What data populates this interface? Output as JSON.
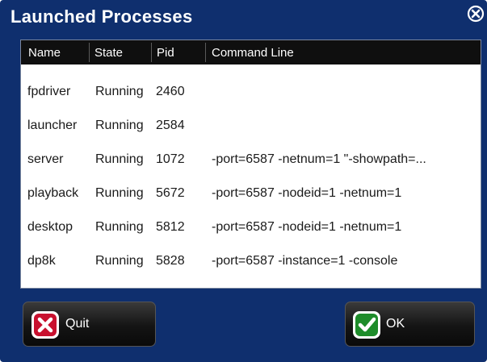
{
  "window": {
    "title": "Launched Processes"
  },
  "table": {
    "columns": [
      "Name",
      "State",
      "Pid",
      "Command Line"
    ],
    "rows": [
      {
        "name": "fpdriver",
        "state": "Running",
        "pid": "2460",
        "cmd": ""
      },
      {
        "name": "launcher",
        "state": "Running",
        "pid": "2584",
        "cmd": ""
      },
      {
        "name": "server",
        "state": "Running",
        "pid": "1072",
        "cmd": "-port=6587 -netnum=1 \"-showpath=..."
      },
      {
        "name": "playback",
        "state": "Running",
        "pid": "5672",
        "cmd": "-port=6587 -nodeid=1 -netnum=1"
      },
      {
        "name": "desktop",
        "state": "Running",
        "pid": "5812",
        "cmd": " -port=6587 -nodeid=1 -netnum=1"
      },
      {
        "name": "dp8k",
        "state": "Running",
        "pid": "5828",
        "cmd": " -port=6587 -instance=1 -console"
      }
    ]
  },
  "buttons": {
    "quit_label": "Quit",
    "ok_label": "OK"
  },
  "colors": {
    "background": "#0f2f6e",
    "header": "#0f0f0f",
    "quit_icon": "#c8102e",
    "ok_icon": "#1e8c2a"
  },
  "icons": {
    "close": "close-circle-x-icon",
    "quit": "red-x-icon",
    "ok": "green-check-icon"
  }
}
